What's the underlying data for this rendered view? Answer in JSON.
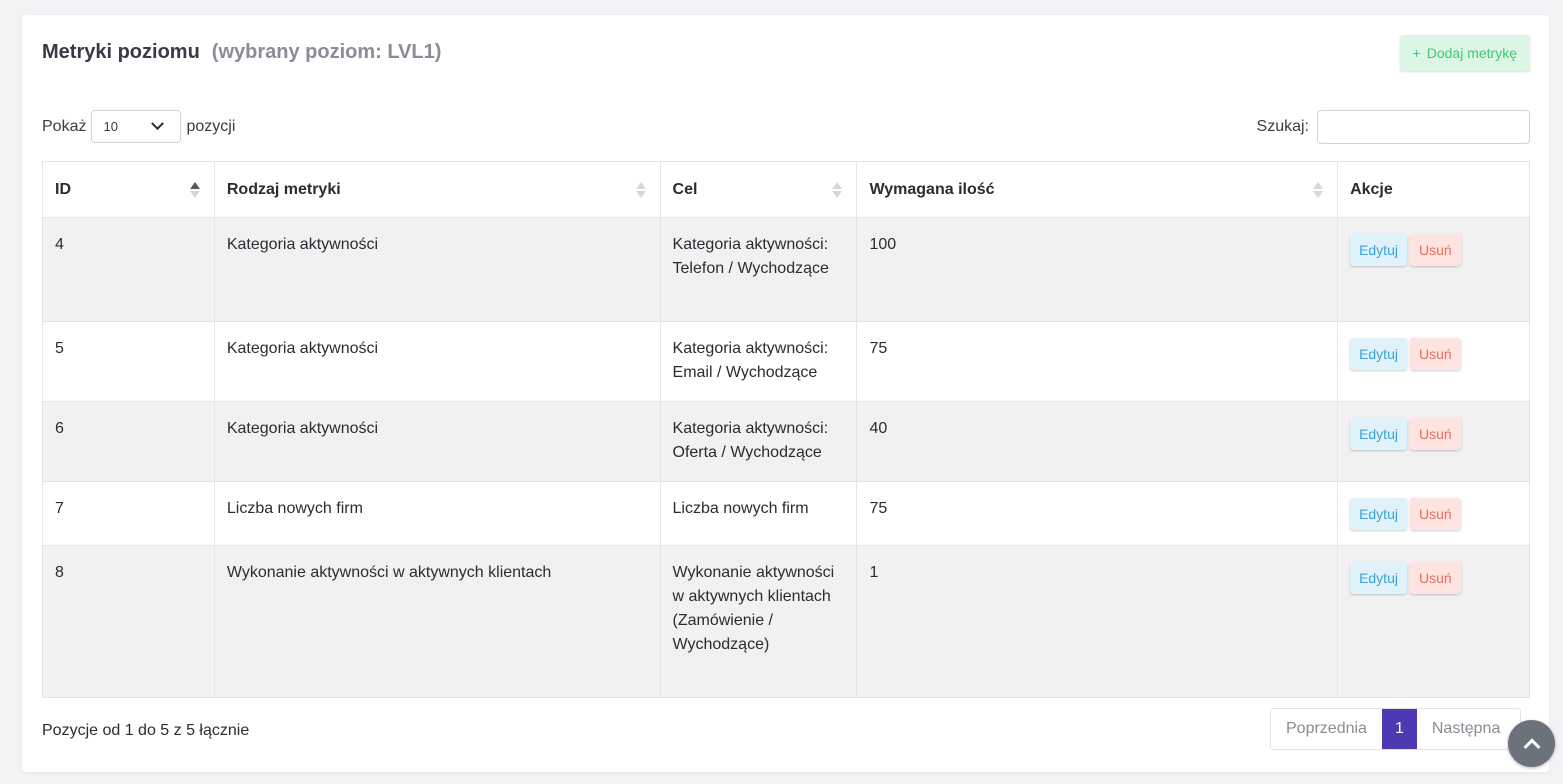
{
  "header": {
    "title": "Metryki poziomu",
    "subtitle": "(wybrany poziom: LVL1)",
    "add_button": "Dodaj metrykę",
    "add_icon": "+"
  },
  "controls": {
    "show_label": "Pokaż",
    "page_size": "10",
    "entries_label": "pozycji",
    "search_label": "Szukaj:",
    "search_value": ""
  },
  "table": {
    "columns": [
      {
        "label": "ID",
        "sort": "asc"
      },
      {
        "label": "Rodzaj metryki",
        "sort": "none"
      },
      {
        "label": "Cel",
        "sort": "none"
      },
      {
        "label": "Wymagana ilość",
        "sort": "none"
      },
      {
        "label": "Akcje"
      }
    ],
    "rows": [
      {
        "id": "4",
        "type": "Kategoria aktywności",
        "goal": "Kategoria aktywności: Telefon / Wychodzące",
        "qty": "100"
      },
      {
        "id": "5",
        "type": "Kategoria aktywności",
        "goal": "Kategoria aktywności: Email / Wychodzące",
        "qty": "75"
      },
      {
        "id": "6",
        "type": "Kategoria aktywności",
        "goal": "Kategoria aktywności: Oferta / Wychodzące",
        "qty": "40"
      },
      {
        "id": "7",
        "type": "Liczba nowych firm",
        "goal": "Liczba nowych firm",
        "qty": "75"
      },
      {
        "id": "8",
        "type": "Wykonanie aktywności w aktywnych klientach",
        "goal": "Wykonanie aktywności w aktywnych klientach (Zamówienie / Wychodzące)",
        "qty": "1"
      }
    ],
    "edit_label": "Edytuj",
    "delete_label": "Usuń"
  },
  "footer": {
    "info": "Pozycje od 1 do 5 z 5 łącznie",
    "prev": "Poprzednia",
    "current_page": "1",
    "next": "Następna"
  }
}
